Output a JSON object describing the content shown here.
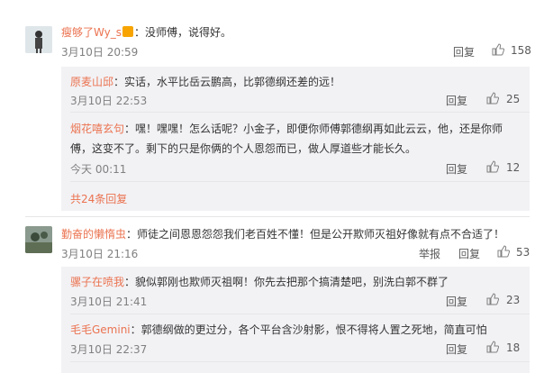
{
  "colors": {
    "name": "#eb7350",
    "muted": "#808080",
    "sub_bg": "#f2f2f5"
  },
  "icons": {
    "thumb": "thumbs-up-icon",
    "vip": "vip-badge-icon"
  },
  "actions": {
    "reply": "回复",
    "report": "举报"
  },
  "c1": {
    "name": "瘦够了Wy_s",
    "text": "：没师傅，说得好。",
    "time": "3月10日 20:59",
    "likes": "158"
  },
  "r1": {
    "name": "原麦山邱",
    "text": "：实话，水平比岳云鹏高，比郭德纲还差的远！",
    "time": "3月10日 22:53",
    "likes": "25"
  },
  "r2": {
    "name": "烟花嘻玄句",
    "text1": "：嘿！嘿嘿！怎么话呢？小金子，即便你师傅郭德纲再如此云云，他，还是你师",
    "text2": "傅，这变不了。剩下的只是你俩的个人恩怨而已，做人厚道些才能长久。",
    "time": "今天 00:11",
    "likes": "12"
  },
  "more": "共24条回复",
  "c2": {
    "name": "勤奋的懒惰虫",
    "text": "：师徒之间恩恩怨怨我们老百姓不懂！但是公开欺师灭祖好像就有点不合适了！",
    "time": "3月10日 21:16",
    "likes": "53"
  },
  "r3": {
    "name": "骡子在喷我",
    "text": "：貌似郭刚也欺师灭祖啊！你先去把那个搞清楚吧，别洗白郭不群了",
    "time": "3月10日 21:41",
    "likes": "23"
  },
  "r4": {
    "name": "毛毛Gemini",
    "text": "：郭德纲做的更过分，各个平台含沙射影，恨不得将人置之死地，简直可怕",
    "time": "3月10日 22:37",
    "likes": "18"
  }
}
